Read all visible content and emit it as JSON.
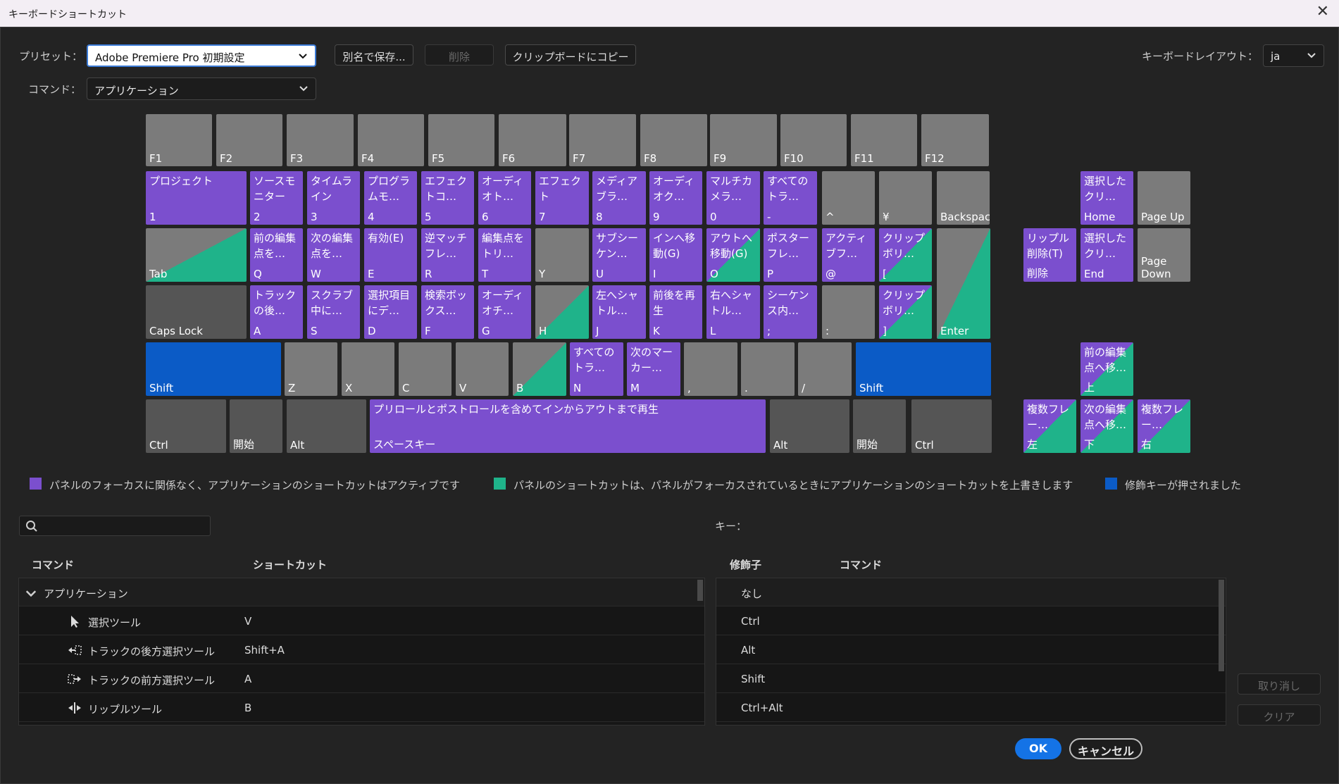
{
  "window": {
    "title": "キーボードショートカット",
    "close": "✕"
  },
  "preset": {
    "label": "プリセット：",
    "value": "Adobe Premiere Pro 初期設定"
  },
  "buttons": {
    "save_as": "別名で保存...",
    "delete": "削除",
    "copy_clipboard": "クリップボードにコピー",
    "undo": "取り消し",
    "clear": "クリア",
    "ok": "OK",
    "cancel": "キャンセル"
  },
  "keyboard_layout": {
    "label": "キーボードレイアウト：",
    "value": "ja"
  },
  "command_filter": {
    "label": "コマンド：",
    "value": "アプリケーション"
  },
  "colors": {
    "app": "#7b4fce",
    "panel": "#1fb38a",
    "modifier": "#0b5bc6",
    "key": "#7b7b7b",
    "key_dark": "#555555"
  },
  "keys": [
    {
      "label": "F1",
      "command": "",
      "style": "gray"
    },
    {
      "label": "F2",
      "command": "",
      "style": "gray"
    },
    {
      "label": "F3",
      "command": "",
      "style": "gray"
    },
    {
      "label": "F4",
      "command": "",
      "style": "gray"
    },
    {
      "label": "F5",
      "command": "",
      "style": "gray"
    },
    {
      "label": "F6",
      "command": "",
      "style": "gray"
    },
    {
      "label": "F7",
      "command": "",
      "style": "gray"
    },
    {
      "label": "F8",
      "command": "",
      "style": "gray"
    },
    {
      "label": "F9",
      "command": "",
      "style": "gray"
    },
    {
      "label": "F10",
      "command": "",
      "style": "gray"
    },
    {
      "label": "F11",
      "command": "",
      "style": "gray"
    },
    {
      "label": "F12",
      "command": "",
      "style": "gray"
    },
    {
      "label": "1",
      "command": "プロジェクト",
      "style": "purple"
    },
    {
      "label": "2",
      "command": "ソースモニター",
      "style": "purple"
    },
    {
      "label": "3",
      "command": "タイムライン",
      "style": "purple"
    },
    {
      "label": "4",
      "command": "プログラムモ…",
      "style": "purple"
    },
    {
      "label": "5",
      "command": "エフェクトコ…",
      "style": "purple"
    },
    {
      "label": "6",
      "command": "オーディオト…",
      "style": "purple"
    },
    {
      "label": "7",
      "command": "エフェクト",
      "style": "purple"
    },
    {
      "label": "8",
      "command": "メディアブラ…",
      "style": "purple"
    },
    {
      "label": "9",
      "command": "オーディオク…",
      "style": "purple"
    },
    {
      "label": "0",
      "command": "マルチカメラ…",
      "style": "purple"
    },
    {
      "label": "-",
      "command": "すべてのトラ…",
      "style": "purple"
    },
    {
      "label": "^",
      "command": "",
      "style": "gray"
    },
    {
      "label": "¥",
      "command": "",
      "style": "gray"
    },
    {
      "label": "Backspace",
      "command": "",
      "style": "gray"
    },
    {
      "label": "Tab",
      "command": "",
      "style": "tri-gp"
    },
    {
      "label": "Q",
      "command": "前の編集点を…",
      "style": "purple"
    },
    {
      "label": "W",
      "command": "次の編集点を…",
      "style": "purple"
    },
    {
      "label": "E",
      "command": "有効(E)",
      "style": "purple"
    },
    {
      "label": "R",
      "command": "逆マッチフレ…",
      "style": "purple"
    },
    {
      "label": "T",
      "command": "編集点をトリ…",
      "style": "purple"
    },
    {
      "label": "Y",
      "command": "",
      "style": "gray"
    },
    {
      "label": "U",
      "command": "サブシーケン…",
      "style": "purple"
    },
    {
      "label": "I",
      "command": "インへ移動(G)",
      "style": "purple"
    },
    {
      "label": "O",
      "command": "アウトへ移動(G)",
      "style": "tri-pg"
    },
    {
      "label": "P",
      "command": "ポスターフレ…",
      "style": "purple"
    },
    {
      "label": "@",
      "command": "アクティブフ…",
      "style": "purple"
    },
    {
      "label": "[",
      "command": "クリップボリ…",
      "style": "tri-pg"
    },
    {
      "label": "Enter",
      "command": "",
      "style": "tri-gp"
    },
    {
      "label": "Caps Lock",
      "command": "",
      "style": "dark"
    },
    {
      "label": "A",
      "command": "トラックの後…",
      "style": "purple"
    },
    {
      "label": "S",
      "command": "スクラブ中に…",
      "style": "purple"
    },
    {
      "label": "D",
      "command": "選択項目にデ…",
      "style": "purple"
    },
    {
      "label": "F",
      "command": "検索ボックス…",
      "style": "purple"
    },
    {
      "label": "G",
      "command": "オーディオチ…",
      "style": "purple"
    },
    {
      "label": "H",
      "command": "",
      "style": "tri-gp"
    },
    {
      "label": "J",
      "command": "左へシャトル…",
      "style": "purple"
    },
    {
      "label": "K",
      "command": "前後を再生",
      "style": "purple"
    },
    {
      "label": "L",
      "command": "右へシャトル…",
      "style": "purple"
    },
    {
      "label": ";",
      "command": "シーケンス内…",
      "style": "purple"
    },
    {
      "label": ":",
      "command": "",
      "style": "gray"
    },
    {
      "label": "]",
      "command": "クリップボリ…",
      "style": "tri-pg"
    },
    {
      "label": "Shift",
      "command": "",
      "style": "blue"
    },
    {
      "label": "Z",
      "command": "",
      "style": "gray"
    },
    {
      "label": "X",
      "command": "",
      "style": "gray"
    },
    {
      "label": "C",
      "command": "",
      "style": "gray"
    },
    {
      "label": "V",
      "command": "",
      "style": "gray"
    },
    {
      "label": "B",
      "command": "",
      "style": "tri-gp"
    },
    {
      "label": "N",
      "command": "すべてのトラ…",
      "style": "purple"
    },
    {
      "label": "M",
      "command": "次のマーカー…",
      "style": "purple"
    },
    {
      "label": ",",
      "command": "",
      "style": "gray"
    },
    {
      "label": ".",
      "command": "",
      "style": "gray"
    },
    {
      "label": "/",
      "command": "",
      "style": "gray"
    },
    {
      "label": "Shift",
      "command": "",
      "style": "blue"
    },
    {
      "label": "Ctrl",
      "command": "",
      "style": "dark"
    },
    {
      "label": "開始",
      "command": "",
      "style": "dark"
    },
    {
      "label": "Alt",
      "command": "",
      "style": "dark"
    },
    {
      "label": "スペースキー",
      "command": "プリロールとポストロールを含めてインからアウトまで再生",
      "style": "purple"
    },
    {
      "label": "Alt",
      "command": "",
      "style": "dark"
    },
    {
      "label": "開始",
      "command": "",
      "style": "dark"
    },
    {
      "label": "Ctrl",
      "command": "",
      "style": "dark"
    },
    {
      "label": "Home",
      "command": "選択したクリ…",
      "style": "purple"
    },
    {
      "label": "Page Up",
      "command": "",
      "style": "gray"
    },
    {
      "label": "削除",
      "command": "リップル削除(T)",
      "style": "purple"
    },
    {
      "label": "End",
      "command": "選択したクリ…",
      "style": "purple"
    },
    {
      "label": "Page Down",
      "command": "",
      "style": "gray"
    },
    {
      "label": "上",
      "command": "前の編集点へ移…",
      "style": "tri-pg"
    },
    {
      "label": "左",
      "command": "複数フレー…",
      "style": "tri-pg"
    },
    {
      "label": "下",
      "command": "次の編集点へ移…",
      "style": "tri-pg"
    },
    {
      "label": "右",
      "command": "複数フレー…",
      "style": "tri-pg"
    }
  ],
  "legend": [
    {
      "text": "パネルのフォーカスに関係なく、アプリケーションのショートカットはアクティブです",
      "color": "#7b4fce"
    },
    {
      "text": "パネルのショートカットは、パネルがフォーカスされているときにアプリケーションのショートカットを上書きします",
      "color": "#1fb38a"
    },
    {
      "text": "修飾キーが押されました",
      "color": "#0b5bc6"
    }
  ],
  "search": {
    "placeholder": "",
    "icon": "search-icon"
  },
  "key_detail": {
    "label": "キー："
  },
  "command_table": {
    "headers": [
      "コマンド",
      "ショートカット"
    ],
    "group": "アプリケーション",
    "rows": [
      {
        "icon": "selection-tool-icon",
        "name": "選択ツール",
        "shortcut": "V"
      },
      {
        "icon": "track-select-backward-icon",
        "name": "トラックの後方選択ツール",
        "shortcut": "Shift+A"
      },
      {
        "icon": "track-select-forward-icon",
        "name": "トラックの前方選択ツール",
        "shortcut": "A"
      },
      {
        "icon": "ripple-edit-icon",
        "name": "リップルツール",
        "shortcut": "B"
      }
    ]
  },
  "modifier_table": {
    "headers": [
      "修飾子",
      "コマンド"
    ],
    "rows": [
      {
        "modifier": "なし",
        "command": ""
      },
      {
        "modifier": "Ctrl",
        "command": ""
      },
      {
        "modifier": "Alt",
        "command": ""
      },
      {
        "modifier": "Shift",
        "command": ""
      },
      {
        "modifier": "Ctrl+Alt",
        "command": ""
      }
    ]
  }
}
